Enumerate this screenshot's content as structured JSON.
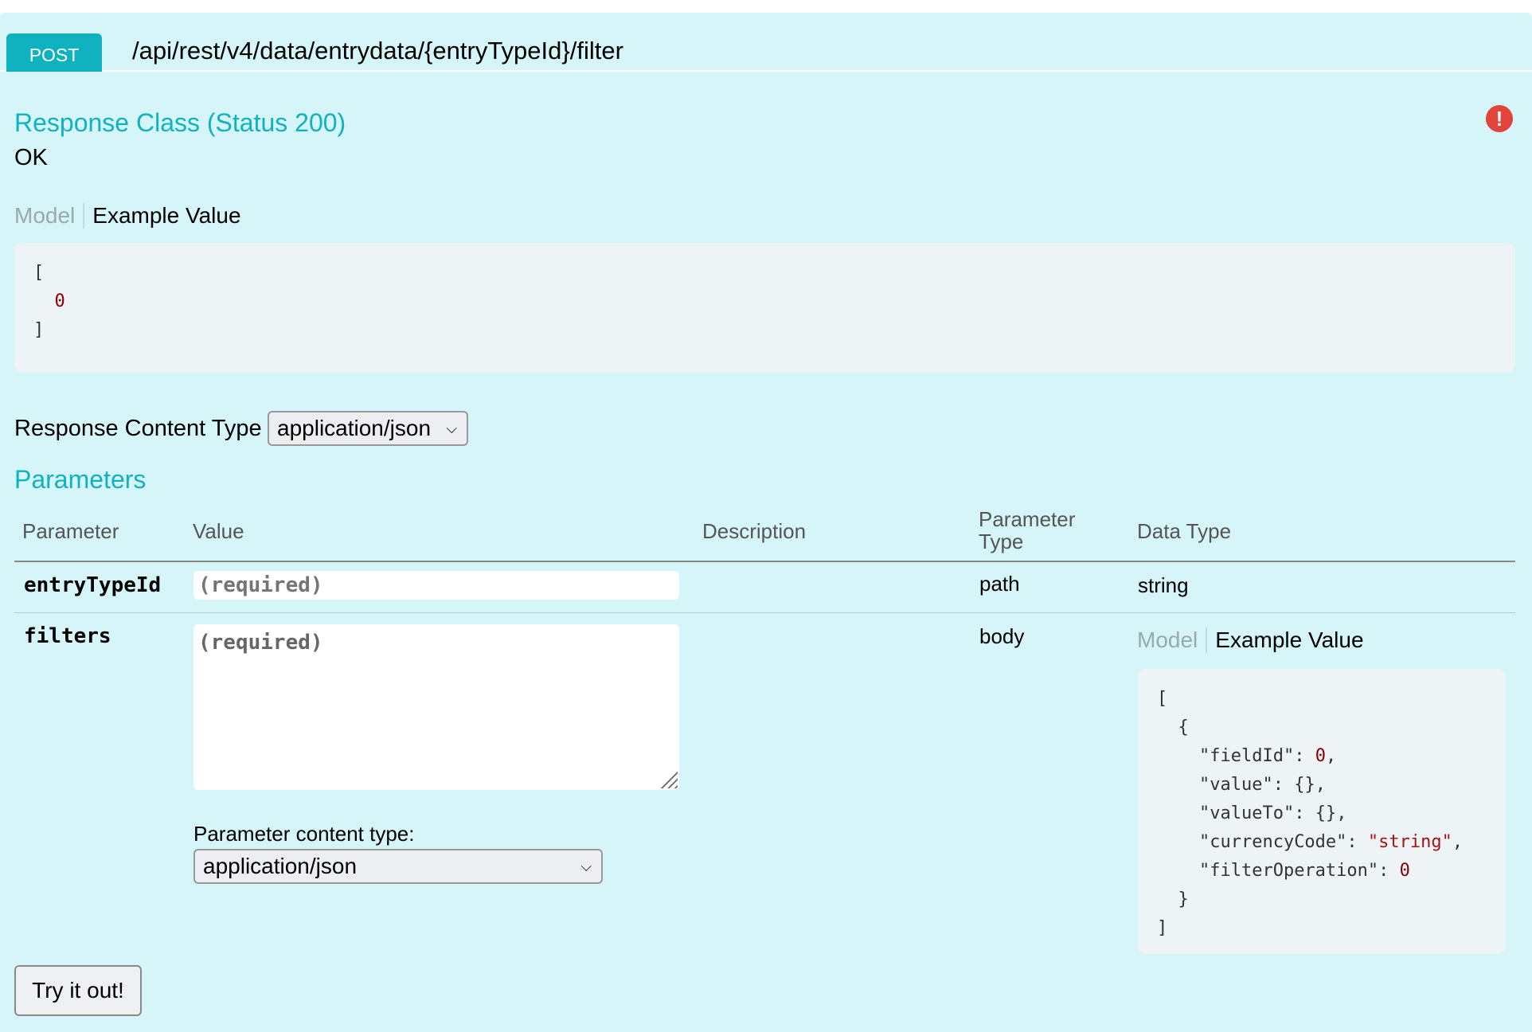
{
  "endpoint": {
    "method": "POST",
    "path": "/api/rest/v4/data/entrydata/{entryTypeId}/filter"
  },
  "response": {
    "title": "Response Class (Status 200)",
    "status_text": "OK",
    "tab_model": "Model",
    "tab_example": "Example Value",
    "example_lines": [
      "[",
      "  0",
      "]"
    ],
    "content_type_label": "Response Content Type",
    "content_type_value": "application/json"
  },
  "parameters": {
    "title": "Parameters",
    "headers": [
      "Parameter",
      "Value",
      "Description",
      "Parameter Type",
      "Data Type"
    ],
    "rows": [
      {
        "name": "entryTypeId",
        "placeholder": "(required)",
        "param_type": "path",
        "data_type": "string"
      },
      {
        "name": "filters",
        "placeholder": "(required)",
        "param_type": "body",
        "data_type_tab_model": "Model",
        "data_type_tab_example": "Example Value",
        "content_type_label": "Parameter content type:",
        "content_type_value": "application/json"
      }
    ],
    "filters_example": {
      "field1": "\"fieldId\"",
      "value1": "0",
      "field2": "\"value\"",
      "value2": "{}",
      "field3": "\"valueTo\"",
      "value3": "{}",
      "field4": "\"currencyCode\"",
      "value4": "\"string\"",
      "field5": "\"filterOperation\"",
      "value5": "0"
    }
  },
  "actions": {
    "try_label": "Try it out!"
  },
  "colors": {
    "accent": "#10b2c0",
    "panel_bg": "#d6f5f8",
    "error": "#e0443b"
  }
}
